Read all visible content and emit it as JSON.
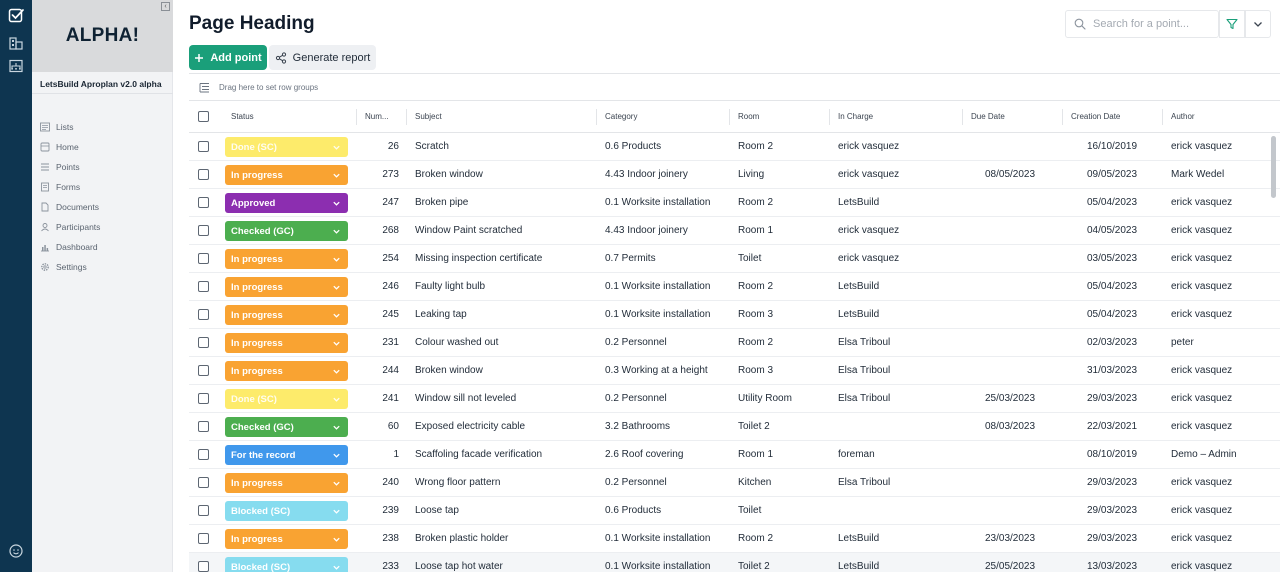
{
  "sidebar": {
    "logo": "ALPHA!",
    "collapse_icon": "collapse-icon",
    "app_version": "LetsBuild Aproplan v2.0 alpha",
    "items": [
      {
        "label": "Lists",
        "icon": "list-icon"
      },
      {
        "label": "Home",
        "icon": "home-icon"
      },
      {
        "label": "Points",
        "icon": "points-icon"
      },
      {
        "label": "Forms",
        "icon": "forms-icon"
      },
      {
        "label": "Documents",
        "icon": "document-icon"
      },
      {
        "label": "Participants",
        "icon": "participants-icon"
      },
      {
        "label": "Dashboard",
        "icon": "dashboard-icon"
      },
      {
        "label": "Settings",
        "icon": "gear-icon"
      }
    ]
  },
  "rail": {
    "icons": [
      "checkbox-logo-icon",
      "buildings-icon",
      "org-chart-icon",
      "smiley-icon"
    ]
  },
  "header": {
    "title": "Page Heading",
    "search_placeholder": "Search for a point...",
    "add_label": "Add point",
    "generate_label": "Generate report"
  },
  "colors": {
    "rail_bg": "#0e3550",
    "brand_green": "#1a9f7a",
    "status": {
      "done": "#fdeb6b",
      "progress": "#f9a332",
      "approved": "#8c2eb0",
      "checked": "#4cae4f",
      "record": "#4098ec",
      "blocked": "#86dcef"
    }
  },
  "table": {
    "group_hint": "Drag here to set row groups",
    "columns": {
      "status": "Status",
      "number": "Num...",
      "subject": "Subject",
      "category": "Category",
      "room": "Room",
      "in_charge": "In Charge",
      "due_date": "Due Date",
      "creation_date": "Creation Date",
      "author": "Author"
    },
    "rows": [
      {
        "status": "Done (SC)",
        "kind": "done",
        "num": "26",
        "subject": "Scratch",
        "category": "0.6 Products",
        "room": "Room 2",
        "in_charge": "erick vasquez",
        "due": "",
        "created": "16/10/2019",
        "author": "erick vasquez"
      },
      {
        "status": "In progress",
        "kind": "progress",
        "num": "273",
        "subject": "Broken window",
        "category": "4.43 Indoor joinery",
        "room": "Living",
        "in_charge": "erick vasquez",
        "due": "08/05/2023",
        "created": "09/05/2023",
        "author": "Mark Wedel"
      },
      {
        "status": "Approved",
        "kind": "approved",
        "num": "247",
        "subject": "Broken pipe",
        "category": "0.1 Worksite installation",
        "room": "Room 2",
        "in_charge": "LetsBuild",
        "due": "",
        "created": "05/04/2023",
        "author": "erick vasquez"
      },
      {
        "status": "Checked (GC)",
        "kind": "checked",
        "num": "268",
        "subject": "Window Paint scratched",
        "category": "4.43 Indoor joinery",
        "room": "Room 1",
        "in_charge": "erick vasquez",
        "due": "",
        "created": "04/05/2023",
        "author": "erick vasquez"
      },
      {
        "status": "In progress",
        "kind": "progress",
        "num": "254",
        "subject": "Missing inspection certificate",
        "category": "0.7 Permits",
        "room": "Toilet",
        "in_charge": "erick vasquez",
        "due": "",
        "created": "03/05/2023",
        "author": "erick vasquez"
      },
      {
        "status": "In progress",
        "kind": "progress",
        "num": "246",
        "subject": "Faulty light bulb",
        "category": "0.1 Worksite installation",
        "room": "Room 2",
        "in_charge": "LetsBuild",
        "due": "",
        "created": "05/04/2023",
        "author": "erick vasquez"
      },
      {
        "status": "In progress",
        "kind": "progress",
        "num": "245",
        "subject": "Leaking tap",
        "category": "0.1 Worksite installation",
        "room": "Room 3",
        "in_charge": "LetsBuild",
        "due": "",
        "created": "05/04/2023",
        "author": "erick vasquez"
      },
      {
        "status": "In progress",
        "kind": "progress",
        "num": "231",
        "subject": "Colour washed out",
        "category": "0.2 Personnel",
        "room": "Room 2",
        "in_charge": "Elsa Triboul",
        "due": "",
        "created": "02/03/2023",
        "author": "peter"
      },
      {
        "status": "In progress",
        "kind": "progress",
        "num": "244",
        "subject": "Broken window",
        "category": "0.3 Working at a height",
        "room": "Room 3",
        "in_charge": "Elsa Triboul",
        "due": "",
        "created": "31/03/2023",
        "author": "erick vasquez"
      },
      {
        "status": "Done (SC)",
        "kind": "done",
        "num": "241",
        "subject": "Window sill not leveled",
        "category": "0.2 Personnel",
        "room": "Utility Room",
        "in_charge": "Elsa Triboul",
        "due": "25/03/2023",
        "created": "29/03/2023",
        "author": "erick vasquez"
      },
      {
        "status": "Checked (GC)",
        "kind": "checked",
        "num": "60",
        "subject": "Exposed electricity cable",
        "category": "3.2 Bathrooms",
        "room": "Toilet 2",
        "in_charge": "",
        "due": "08/03/2023",
        "created": "22/03/2021",
        "author": "erick vasquez"
      },
      {
        "status": "For the record",
        "kind": "record",
        "num": "1",
        "subject": "Scaffoling facade verification",
        "category": "2.6 Roof covering",
        "room": "Room 1",
        "in_charge": "foreman",
        "due": "",
        "created": "08/10/2019",
        "author": "Demo – Admin"
      },
      {
        "status": "In progress",
        "kind": "progress",
        "num": "240",
        "subject": "Wrong floor pattern",
        "category": "0.2 Personnel",
        "room": "Kitchen",
        "in_charge": "Elsa Triboul",
        "due": "",
        "created": "29/03/2023",
        "author": "erick vasquez"
      },
      {
        "status": "Blocked (SC)",
        "kind": "blocked",
        "num": "239",
        "subject": "Loose tap",
        "category": "0.6 Products",
        "room": "Toilet",
        "in_charge": "",
        "due": "",
        "created": "29/03/2023",
        "author": "erick vasquez"
      },
      {
        "status": "In progress",
        "kind": "progress",
        "num": "238",
        "subject": "Broken plastic holder",
        "category": "0.1 Worksite installation",
        "room": "Room 2",
        "in_charge": "LetsBuild",
        "due": "23/03/2023",
        "created": "29/03/2023",
        "author": "erick vasquez"
      },
      {
        "status": "Blocked (SC)",
        "kind": "blocked",
        "num": "233",
        "subject": "Loose tap hot water",
        "category": "0.1 Worksite installation",
        "room": "Toilet 2",
        "in_charge": "LetsBuild",
        "due": "25/05/2023",
        "created": "13/03/2023",
        "author": "erick vasquez"
      }
    ]
  }
}
